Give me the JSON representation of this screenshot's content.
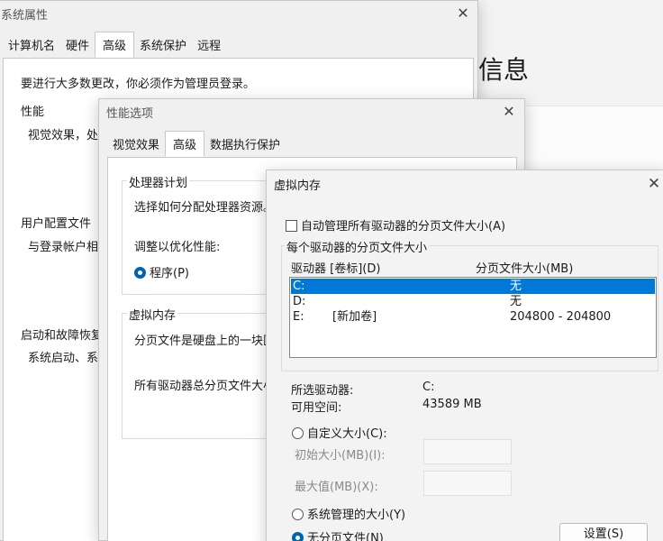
{
  "background": {
    "title": "信息"
  },
  "system_properties": {
    "title": "系统属性",
    "tabs": [
      "计算机名",
      "硬件",
      "高级",
      "系统保护",
      "远程"
    ],
    "admin_note": "要进行大多数更改，你必须作为管理员登录。",
    "performance_label": "性能",
    "performance_desc": "视觉效果，处",
    "user_profile_label": "用户配置文件",
    "user_profile_desc": "与登录帐户相",
    "startup_label": "启动和故障恢复",
    "startup_desc": "系统启动、系"
  },
  "performance_options": {
    "title": "性能选项",
    "tabs": [
      "视觉效果",
      "高级",
      "数据执行保护"
    ],
    "processor_group": "处理器计划",
    "processor_desc": "选择如何分配处理器资源。",
    "adjust_label": "调整以优化性能:",
    "program_radio": "程序(P)",
    "vm_group": "虚拟内存",
    "vm_desc": "分页文件是硬盘上的一块区",
    "vm_total": "所有驱动器总分页文件大小"
  },
  "virtual_memory": {
    "title": "虚拟内存",
    "auto_manage": "自动管理所有驱动器的分页文件大小(A)",
    "per_drive_group": "每个驱动器的分页文件大小",
    "columns": [
      "驱动器 [卷标](D)",
      "分页文件大小(MB)"
    ],
    "drives": [
      {
        "drive": "C:",
        "label": "",
        "size": "无"
      },
      {
        "drive": "D:",
        "label": "",
        "size": "无"
      },
      {
        "drive": "E:",
        "label": "[新加卷]",
        "size": "204800 - 204800"
      }
    ],
    "selected_drive_label": "所选驱动器:",
    "selected_drive_value": "C:",
    "free_space_label": "可用空间:",
    "free_space_value": "43589 MB",
    "custom_size": "自定义大小(C):",
    "initial_size": "初始大小(MB)(I):",
    "max_size": "最大值(MB)(X):",
    "system_managed": "系统管理的大小(Y)",
    "no_paging": "无分页文件(N)",
    "set_button": "设置(S)"
  },
  "icons": {
    "close": "close-icon"
  }
}
